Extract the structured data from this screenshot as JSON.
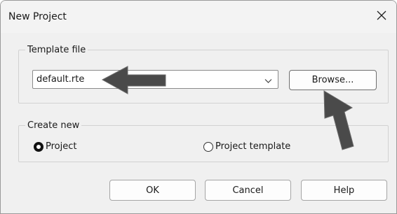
{
  "dialog": {
    "title": "New Project",
    "close_glyph": "✕"
  },
  "template_group": {
    "legend": "Template file",
    "combo_value": "default.rte",
    "browse_label": "Browse..."
  },
  "create_group": {
    "legend": "Create new",
    "options": [
      {
        "label": "Project",
        "selected": true
      },
      {
        "label": "Project template",
        "selected": false
      }
    ]
  },
  "buttons": {
    "ok": "OK",
    "cancel": "Cancel",
    "help": "Help"
  },
  "annotations": {
    "arrow_color": "#4a4a4a",
    "arrows": [
      "arrow-to-template-combo",
      "arrow-to-browse-button"
    ]
  }
}
